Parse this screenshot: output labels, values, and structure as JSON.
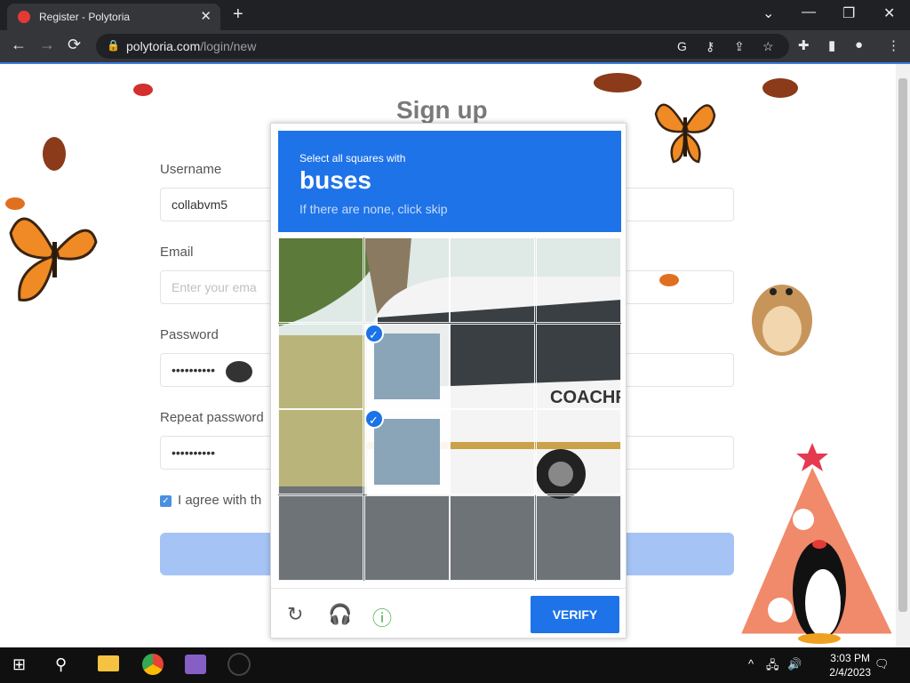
{
  "browser": {
    "tab_title": "Register - Polytoria",
    "tab_close": "✕",
    "new_tab": "+",
    "url_domain": "polytoria.com",
    "url_path": "/login/new",
    "window_controls": {
      "minimize": "—",
      "restore": "❐",
      "close": "✕"
    },
    "chevron": "⌄",
    "nav": {
      "back": "←",
      "forward": "→",
      "reload": "⟳"
    },
    "omni_icons": {
      "google": "G",
      "key": "⚷",
      "share": "⇪",
      "bookmark": "☆"
    },
    "toolbar_icons": {
      "extensions": "✚",
      "sidepanel": "▮",
      "profile": "●",
      "menu": "⋮"
    }
  },
  "page": {
    "heading": "Sign up",
    "username_label": "Username",
    "username_value": "collabvm5",
    "email_label": "Email",
    "email_placeholder": "Enter your ema",
    "password_label": "Password",
    "password_value": "••••••••••",
    "repeat_label": "Repeat password",
    "repeat_value": "••••••••••",
    "agree_text": "I agree with th",
    "checkbox_mark": "✓"
  },
  "captcha": {
    "instruction": "Select all squares with",
    "target": "buses",
    "hint": "If there are none, click skip",
    "selected_cells": [
      5,
      9
    ],
    "check_mark": "✓",
    "refresh_icon": "↻",
    "audio_icon": "🎧",
    "info_icon": "ⓘ",
    "verify_label": "VERIFY",
    "scene_text": "COACHPA"
  },
  "taskbar": {
    "start_icon": "⊞",
    "search_icon": "⚲",
    "time": "3:03 PM",
    "date": "2/4/2023",
    "tray": {
      "chevron": "^",
      "network": "🖧",
      "volume": "🔊",
      "notifications": "🗨"
    }
  },
  "colors": {
    "captcha_blue": "#1e73e8",
    "submit_disabled": "#a5c4f5",
    "chrome_dark": "#202124"
  }
}
